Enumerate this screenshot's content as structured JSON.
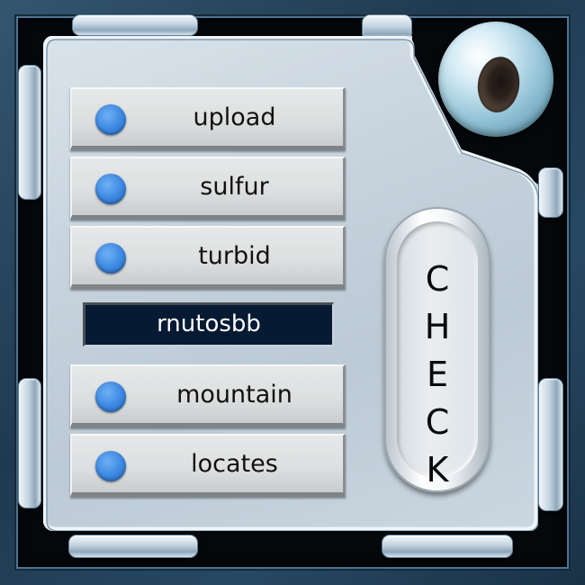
{
  "panel": {
    "options": [
      {
        "label": "upload"
      },
      {
        "label": "sulfur"
      },
      {
        "label": "turbid"
      },
      {
        "label": "mountain"
      },
      {
        "label": "locates"
      }
    ],
    "text_field": {
      "value": "rnutosbb"
    },
    "check_button": {
      "label": "CHECK",
      "letters": [
        "C",
        "H",
        "E",
        "C",
        "K"
      ]
    }
  },
  "colors": {
    "radio_dot": "#3a86e0",
    "field_background": "#061a33",
    "frame": "#274863"
  },
  "icons": {
    "camera": "camera-eye-icon",
    "radio": "blue-dot-icon"
  }
}
